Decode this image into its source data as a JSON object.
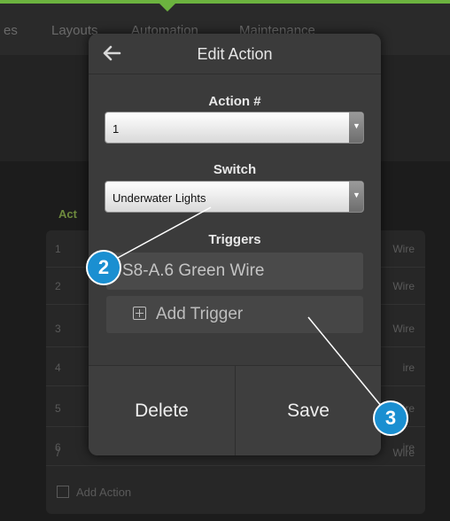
{
  "background": {
    "menu": [
      "es",
      "Layouts",
      "Automation",
      "Maintenance"
    ],
    "list_header": "Act",
    "row_numbers": [
      "1",
      "2",
      "3",
      "4",
      "5",
      "6",
      "7"
    ],
    "row_right": [
      "Wire",
      "Wire",
      "Wire",
      "ire",
      "ire",
      "ire",
      "Wire"
    ],
    "add_action": "Add Action"
  },
  "modal": {
    "title": "Edit Action",
    "back_icon": "arrow-left-icon",
    "action_label": "Action #",
    "action_value": "1",
    "switch_label": "Switch",
    "switch_value": "Underwater Lights",
    "triggers_label": "Triggers",
    "trigger_item": "S8-A.6 Green Wire",
    "add_trigger": "Add Trigger",
    "delete": "Delete",
    "save": "Save"
  },
  "callouts": [
    "2",
    "3"
  ],
  "colors": {
    "accent_green": "#6cb33f",
    "callout_blue": "#1a8fd1"
  }
}
